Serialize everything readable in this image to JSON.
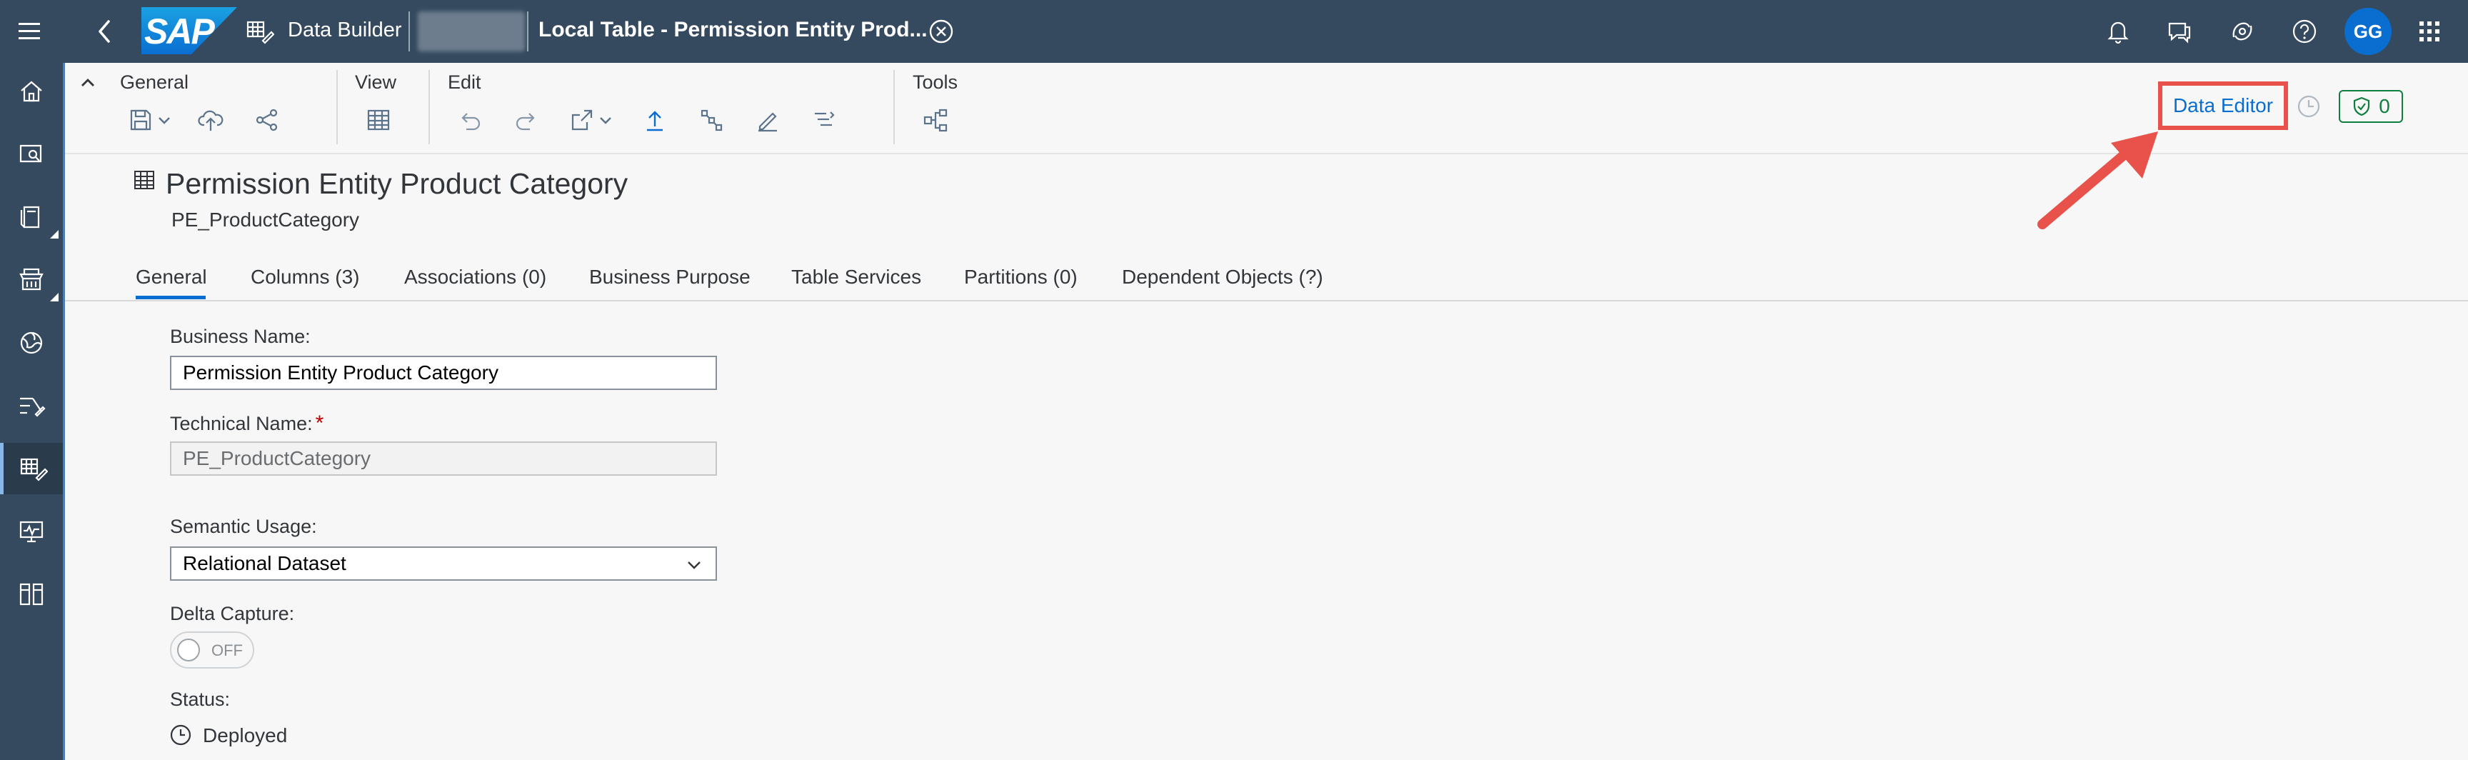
{
  "shell": {
    "logo_text": "SAP",
    "app_name": "Data Builder",
    "space_name": "",
    "doc_title": "Local Table - Permission Entity Prod...",
    "avatar_initials": "GG"
  },
  "toolbar": {
    "groups": {
      "general": "General",
      "view": "View",
      "edit": "Edit",
      "tools": "Tools"
    },
    "data_editor_label": "Data Editor",
    "validation_count": "0"
  },
  "object": {
    "title": "Permission Entity Product Category",
    "technical_name": "PE_ProductCategory"
  },
  "tabs": [
    {
      "label": "General",
      "active": true
    },
    {
      "label": "Columns (3)"
    },
    {
      "label": "Associations (0)"
    },
    {
      "label": "Business Purpose"
    },
    {
      "label": "Table Services"
    },
    {
      "label": "Partitions (0)"
    },
    {
      "label": "Dependent Objects (?)"
    }
  ],
  "form": {
    "business_name_label": "Business Name:",
    "business_name_value": "Permission Entity Product Category",
    "technical_name_label": "Technical Name:",
    "required_marker": "*",
    "technical_name_value": "PE_ProductCategory",
    "semantic_usage_label": "Semantic Usage:",
    "semantic_usage_value": "Relational Dataset",
    "delta_capture_label": "Delta Capture:",
    "delta_capture_state": "OFF",
    "status_label": "Status:",
    "status_value": "Deployed"
  },
  "colors": {
    "shell_bg": "#354a5f",
    "accent": "#0a6ed1",
    "highlight": "#e8524a",
    "success": "#107e3e"
  }
}
